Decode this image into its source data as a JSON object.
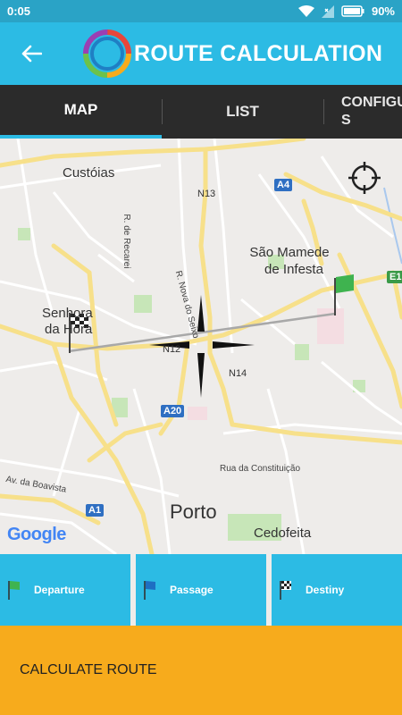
{
  "status_bar": {
    "time": "0:05",
    "battery": "90%"
  },
  "app_bar": {
    "title": "ROUTE CALCULATION"
  },
  "tabs": [
    {
      "label": "MAP"
    },
    {
      "label": "LIST"
    },
    {
      "label": "CONFIGU S"
    }
  ],
  "map": {
    "places": [
      {
        "name": "Custóias"
      },
      {
        "name": "São Mamede"
      },
      {
        "name": "de Infesta"
      },
      {
        "name": "Senhora"
      },
      {
        "name": "da Hora"
      },
      {
        "name": "Porto"
      },
      {
        "name": "Cedofeita"
      }
    ],
    "streets": [
      {
        "name": "R. de Recarei"
      },
      {
        "name": "R. Nova do Seixo"
      },
      {
        "name": "Rua da Constituição"
      },
      {
        "name": "Av. da Boavista"
      }
    ],
    "roads": [
      "N13",
      "N12",
      "N14",
      "A4",
      "A20",
      "A1",
      "E1"
    ],
    "brand": "Google"
  },
  "actions": {
    "departure": "Departure",
    "passage": "Passage",
    "destiny": "Destiny"
  },
  "calculate_label": "CALCULATE ROUTE",
  "colors": {
    "accent": "#2cbbe4",
    "status": "#2aa3c6",
    "calc": "#f7ab1c",
    "tabs": "#2b2b2b"
  }
}
